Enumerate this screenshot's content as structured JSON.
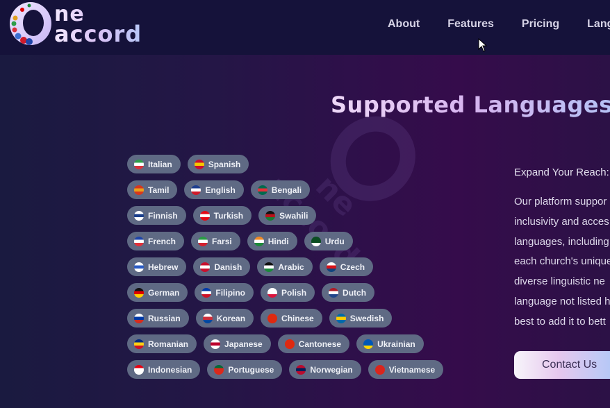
{
  "header": {
    "logo": {
      "line1": "ne",
      "line2": "accord",
      "alt": "One accord"
    },
    "nav": [
      {
        "label": "About"
      },
      {
        "label": "Features"
      },
      {
        "label": "Pricing"
      },
      {
        "label": "Langua"
      }
    ]
  },
  "section": {
    "title": "Supported Languages",
    "subtitle": "Expand Your Reach:",
    "paragraph_lines": [
      "Our platform suppor",
      "inclusivity and acces",
      "languages, including",
      "each church's unique",
      "diverse linguistic ne",
      "language not listed h",
      "best to add it to bett"
    ],
    "contact_button": "Contact Us"
  },
  "languages": [
    [
      {
        "label": "Italian",
        "flag": "italy-flag-icon",
        "colors": [
          "#2e9e4a",
          "#ffffff",
          "#d8323c"
        ]
      },
      {
        "label": "Spanish",
        "flag": "spain-flag-icon",
        "colors": [
          "#c8102e",
          "#f6c700",
          "#c8102e"
        ]
      }
    ],
    [
      {
        "label": "Tamil",
        "flag": "tamil-flag-icon",
        "colors": [
          "#d6371e",
          "#e8a21e",
          "#d6371e"
        ]
      },
      {
        "label": "English",
        "flag": "uk-flag-icon",
        "colors": [
          "#1f3f8f",
          "#ffffff",
          "#cf1b2b"
        ]
      },
      {
        "label": "Bengali",
        "flag": "bangladesh-flag-icon",
        "colors": [
          "#006a4e",
          "#e6313b",
          "#006a4e"
        ]
      }
    ],
    [
      {
        "label": "Finnish",
        "flag": "finland-flag-icon",
        "colors": [
          "#ffffff",
          "#1b3f8b",
          "#ffffff"
        ]
      },
      {
        "label": "Turkish",
        "flag": "turkey-flag-icon",
        "colors": [
          "#e30a17",
          "#ffffff",
          "#e30a17"
        ]
      },
      {
        "label": "Swahili",
        "flag": "kenya-flag-icon",
        "colors": [
          "#111111",
          "#b9121b",
          "#1a7a35"
        ]
      }
    ],
    [
      {
        "label": "French",
        "flag": "france-flag-icon",
        "colors": [
          "#1f45a8",
          "#ffffff",
          "#e1313b"
        ]
      },
      {
        "label": "Farsi",
        "flag": "iran-flag-icon",
        "colors": [
          "#2a9b45",
          "#ffffff",
          "#d3212f"
        ]
      },
      {
        "label": "Hindi",
        "flag": "india-flag-icon",
        "colors": [
          "#f08a24",
          "#ffffff",
          "#1d8a3a"
        ]
      },
      {
        "label": "Urdu",
        "flag": "pakistan-flag-icon",
        "colors": [
          "#0b4d22",
          "#0b4d22",
          "#ffffff"
        ]
      }
    ],
    [
      {
        "label": "Hebrew",
        "flag": "israel-flag-icon",
        "colors": [
          "#ffffff",
          "#2c5cc5",
          "#ffffff"
        ]
      },
      {
        "label": "Danish",
        "flag": "denmark-flag-icon",
        "colors": [
          "#c8102e",
          "#ffffff",
          "#c8102e"
        ]
      },
      {
        "label": "Arabic",
        "flag": "arabic-flag-icon",
        "colors": [
          "#111111",
          "#ffffff",
          "#1a8a3a"
        ]
      },
      {
        "label": "Czech",
        "flag": "czech-flag-icon",
        "colors": [
          "#ffffff",
          "#d7141a",
          "#11457e"
        ]
      }
    ],
    [
      {
        "label": "German",
        "flag": "germany-flag-icon",
        "colors": [
          "#111111",
          "#dd0000",
          "#ffce00"
        ]
      },
      {
        "label": "Filipino",
        "flag": "philippines-flag-icon",
        "colors": [
          "#0038a8",
          "#ffffff",
          "#ce1126"
        ]
      },
      {
        "label": "Polish",
        "flag": "poland-flag-icon",
        "colors": [
          "#ffffff",
          "#ffffff",
          "#dc143c"
        ]
      },
      {
        "label": "Dutch",
        "flag": "netherlands-flag-icon",
        "colors": [
          "#ae1c28",
          "#ffffff",
          "#21468b"
        ]
      }
    ],
    [
      {
        "label": "Russian",
        "flag": "russia-flag-icon",
        "colors": [
          "#ffffff",
          "#0039a6",
          "#d52b1e"
        ]
      },
      {
        "label": "Korean",
        "flag": "korea-flag-icon",
        "colors": [
          "#ffffff",
          "#cd2e3a",
          "#0047a0"
        ]
      },
      {
        "label": "Chinese",
        "flag": "china-flag-icon",
        "colors": [
          "#de2910",
          "#de2910",
          "#de2910"
        ]
      },
      {
        "label": "Swedish",
        "flag": "sweden-flag-icon",
        "colors": [
          "#006aa7",
          "#fecc00",
          "#006aa7"
        ]
      }
    ],
    [
      {
        "label": "Romanian",
        "flag": "romania-flag-icon",
        "colors": [
          "#002b7f",
          "#fcd116",
          "#ce1126"
        ]
      },
      {
        "label": "Japanese",
        "flag": "japan-flag-icon",
        "colors": [
          "#ffffff",
          "#bc002d",
          "#ffffff"
        ]
      },
      {
        "label": "Cantonese",
        "flag": "hongkong-flag-icon",
        "colors": [
          "#de2910",
          "#de2910",
          "#de2910"
        ]
      },
      {
        "label": "Ukrainian",
        "flag": "ukraine-flag-icon",
        "colors": [
          "#0057b7",
          "#0057b7",
          "#ffd700"
        ]
      }
    ],
    [
      {
        "label": "Indonesian",
        "flag": "indonesia-flag-icon",
        "colors": [
          "#e70011",
          "#ffffff",
          "#ffffff"
        ]
      },
      {
        "label": "Portuguese",
        "flag": "portugal-flag-icon",
        "colors": [
          "#046a38",
          "#da291c",
          "#da291c"
        ]
      },
      {
        "label": "Norwegian",
        "flag": "norway-flag-icon",
        "colors": [
          "#ba0c2f",
          "#00205b",
          "#ba0c2f"
        ]
      },
      {
        "label": "Vietnamese",
        "flag": "vietnam-flag-icon",
        "colors": [
          "#da251d",
          "#da251d",
          "#da251d"
        ]
      }
    ]
  ]
}
